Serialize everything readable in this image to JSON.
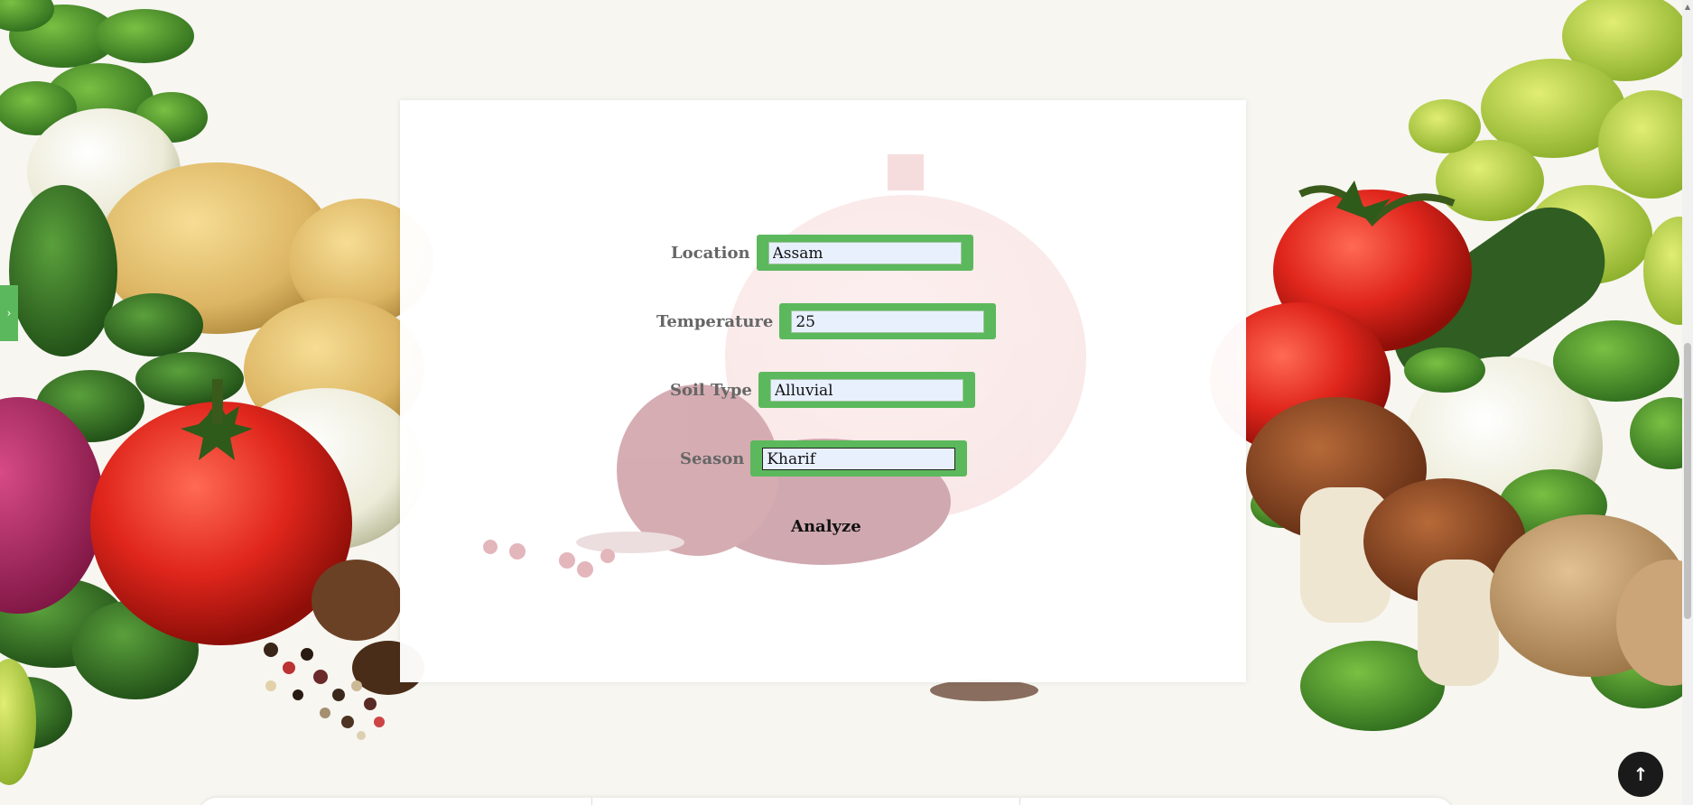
{
  "side_tab": {
    "icon": "chevron-right-icon",
    "glyph": "›"
  },
  "form": {
    "location": {
      "label": "Location",
      "value": "Assam"
    },
    "temperature": {
      "label": "Temperature",
      "value": "25"
    },
    "soil_type": {
      "label": "Soil Type",
      "value": "Alluvial"
    },
    "season": {
      "label": "Season",
      "value": "Kharif"
    },
    "submit_label": "Analyze"
  },
  "back_to_top": {
    "icon": "arrow-up-icon",
    "glyph": "↑"
  },
  "colors": {
    "accent_green": "#5cb85c",
    "input_fill": "#e8f0fe",
    "label_gray": "#666666",
    "back_to_top_bg": "#1a1a1a"
  }
}
